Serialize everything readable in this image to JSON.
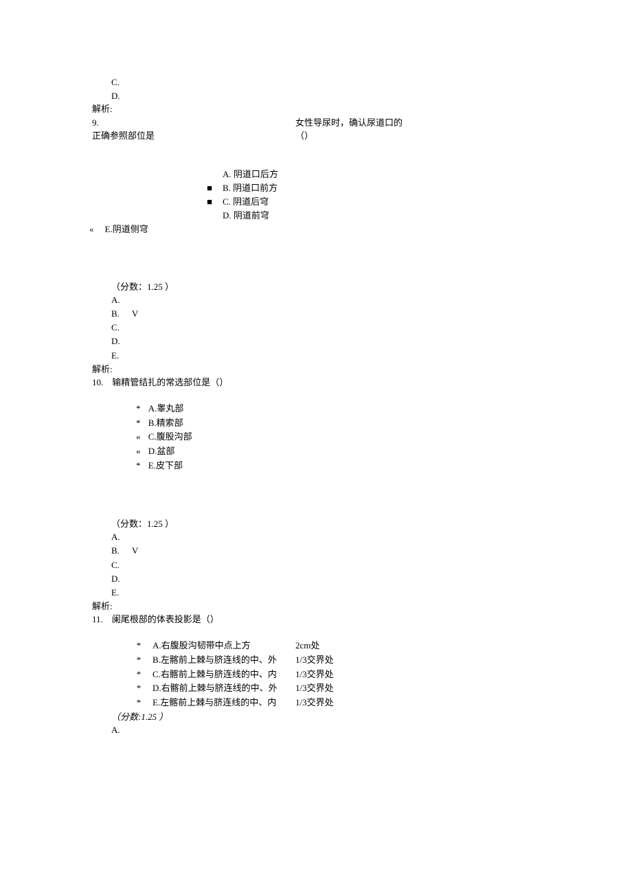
{
  "q8": {
    "opt_c": "C.",
    "opt_d": "D.",
    "analysis": "解析:"
  },
  "q9": {
    "num": "9.",
    "stem_left": "正确参照部位是",
    "stem_right_1": "女性导尿时，确认尿道口的",
    "stem_right_2": "（）",
    "opts": {
      "a": {
        "bullet": "",
        "text": "A. 阴道口后方"
      },
      "b": {
        "bullet": "■",
        "text": "B. 阴道口前方"
      },
      "c": {
        "bullet": "■",
        "text": "C. 阴道后穹"
      },
      "d": {
        "bullet": "",
        "text": "D. 阴道前穹"
      },
      "e": {
        "bullet": "«",
        "text": "E.阴道侧穹"
      }
    },
    "score": "（分数：1.25 ）",
    "ans": {
      "a": "A.",
      "b": "B.",
      "b_mark": "V",
      "c": "C.",
      "d": "D.",
      "e": "E."
    },
    "analysis": "解析:"
  },
  "q10": {
    "num": "10.",
    "stem": "输精管结扎的常选部位是（）",
    "opts": {
      "a": {
        "bullet": "*",
        "text": "A.睾丸部"
      },
      "b": {
        "bullet": "*",
        "text": "B.精索部"
      },
      "c": {
        "bullet": "«",
        "text": "C.腹股沟部"
      },
      "d": {
        "bullet": "«",
        "text": "D.盆部"
      },
      "e": {
        "bullet": "*",
        "text": "E.皮下部"
      }
    },
    "score": "（分数：1.25 ）",
    "ans": {
      "a": "A.",
      "b": "B.",
      "b_mark": "V",
      "c": "C.",
      "d": "D.",
      "e": "E."
    },
    "analysis": "解析:"
  },
  "q11": {
    "num": "11.",
    "stem": "阑尾根部的体表投影是（）",
    "opts": {
      "a": {
        "bullet": "*",
        "main": "A.右腹股沟韧带中点上方",
        "tail": "2cm处"
      },
      "b": {
        "bullet": "*",
        "main": "B.左髂前上棘与脐连线的中、外",
        "tail": "1/3交界处"
      },
      "c": {
        "bullet": "*",
        "main": "C.右髂前上棘与脐连线的中、内",
        "tail": "1/3交界处"
      },
      "d": {
        "bullet": "*",
        "main": "D.右髂前上棘与脐连线的中、外",
        "tail": "1/3交界处"
      },
      "e": {
        "bullet": "*",
        "main": "E.左髂前上棘与脐连线的中、内",
        "tail": "1/3交界处"
      }
    },
    "score": "（分数:1.25 ）",
    "ans_a": "A."
  }
}
